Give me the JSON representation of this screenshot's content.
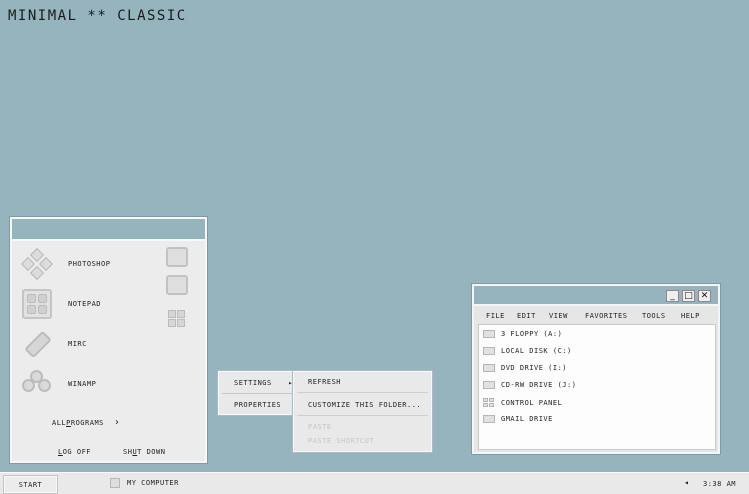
{
  "theme_title": "MINIMAL ** CLASSIC",
  "start_menu": {
    "programs": [
      {
        "label": "PHOTOSHOP",
        "icon": "photoshop-icon"
      },
      {
        "label": "NOTEPAD",
        "icon": "notepad-icon"
      },
      {
        "label": "MIRC",
        "icon": "mirc-icon"
      },
      {
        "label": "WINAMP",
        "icon": "winamp-icon"
      }
    ],
    "all_programs": {
      "prefix": "ALL ",
      "underlined": "P",
      "suffix": "ROGRAMS"
    },
    "all_programs_arrow": "›",
    "log_off": {
      "underlined": "L",
      "suffix": "OG OFF"
    },
    "shut_down": {
      "prefix": "SH",
      "underlined": "U",
      "suffix": "T DOWN"
    }
  },
  "context_menu": {
    "items": [
      {
        "label": "SETTINGS",
        "submenu_arrow": "▸"
      },
      {
        "label": "PROPERTIES"
      }
    ]
  },
  "submenu": {
    "refresh": "REFRESH",
    "customize": "CUSTOMIZE THIS FOLDER...",
    "paste": "PASTE",
    "paste_shortcut": "PASTE SHORTCUT"
  },
  "window": {
    "controls": {
      "minimize": "_",
      "maximize": "□",
      "close": "✕"
    },
    "menu": [
      "FILE",
      "EDIT",
      "VIEW",
      "FAVORITES",
      "TOOLS",
      "HELP"
    ],
    "drives": [
      "3   FLOPPY (A:)",
      "LOCAL DISK (C:)",
      "DVD DRIVE (I:)",
      "CD-RW DRIVE (J:)",
      "CONTROL PANEL",
      "GMAIL DRIVE"
    ]
  },
  "taskbar": {
    "start": "START",
    "task": "MY COMPUTER",
    "tray_arrow": "◂",
    "clock": "3:38 AM"
  }
}
